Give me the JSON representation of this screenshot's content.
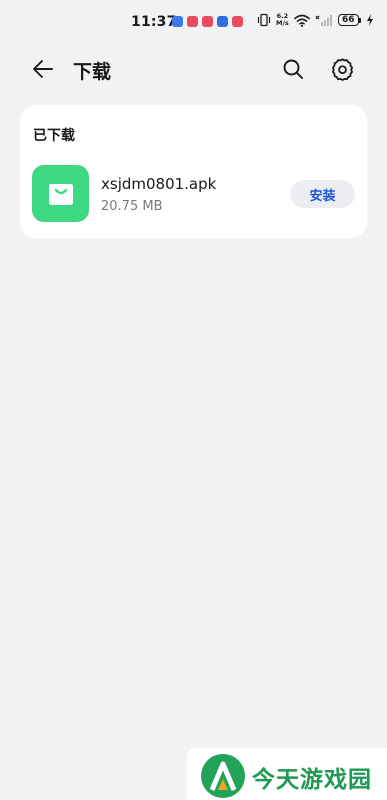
{
  "status_bar": {
    "time": "11:37",
    "net_speed_value": "6.2",
    "net_speed_unit": "M/s",
    "battery": "66",
    "notification_colors": [
      "#3a7be8",
      "#e84a5f",
      "#e84a5f",
      "#2f6fe0",
      "#e84a5f"
    ]
  },
  "header": {
    "title": "下载"
  },
  "downloads": {
    "section_title": "已下载",
    "items": [
      {
        "file_name": "xsjdm0801.apk",
        "file_size": "20.75 MB",
        "action_label": "安装",
        "icon": "shopping-bag-icon",
        "icon_color": "#3ed882"
      }
    ]
  },
  "watermark": {
    "text": "今天游戏园"
  },
  "colors": {
    "background": "#f1f2f4",
    "accent": "#1f56d8",
    "watermark_green": "#1f9a52"
  }
}
